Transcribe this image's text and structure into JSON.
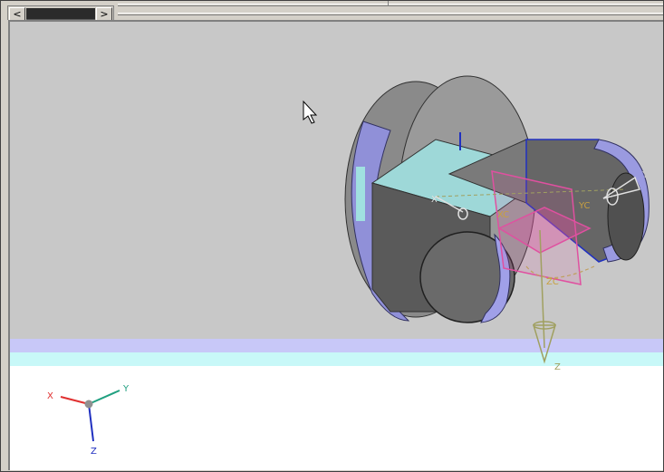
{
  "scrollbar": {
    "left_arrow": "<",
    "right_arrow": ">"
  },
  "triad": {
    "x": "X",
    "y": "Y",
    "z": "Z"
  },
  "model_labels": {
    "yc_right": "YC",
    "zc": "ZC",
    "xc": "XC",
    "y_axis": "Y",
    "z_axis": "Z",
    "x_axis": "X"
  },
  "colors": {
    "viewport_bg": "#c8c8c8",
    "band_lavender": "#c8c8f8",
    "band_cyan": "#c8f8f8",
    "triad_x": "#e03030",
    "triad_y": "#20a080",
    "triad_z": "#2030c0",
    "csys": "#e050a0",
    "axis_olive": "#a0a060"
  }
}
